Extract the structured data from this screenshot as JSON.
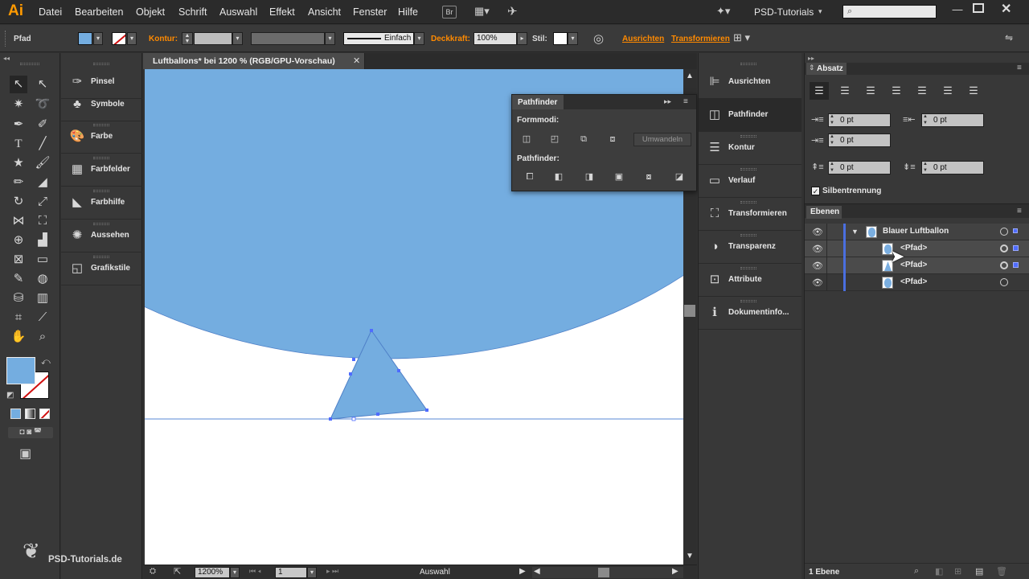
{
  "app": {
    "logo": "Ai",
    "workspace": "PSD-Tutorials"
  },
  "menu": [
    "Datei",
    "Bearbeiten",
    "Objekt",
    "Schrift",
    "Auswahl",
    "Effekt",
    "Ansicht",
    "Fenster",
    "Hilfe"
  ],
  "menubar_icons": {
    "bridge": "Br"
  },
  "controlbar": {
    "object_type": "Pfad",
    "kontur_label": "Kontur:",
    "stroke_profile": "Einfach",
    "opacity_label": "Deckkraft:",
    "opacity_value": "100%",
    "style_label": "Stil:",
    "align_link": "Ausrichten",
    "transform_link": "Transformieren"
  },
  "colors": {
    "fill": "#74ade0",
    "accent": "#ff8a00",
    "selection": "#4f6cff"
  },
  "left_panels": [
    "Pinsel",
    "Symbole",
    "Farbe",
    "Farbfelder",
    "Farbhilfe",
    "Aussehen",
    "Grafikstile"
  ],
  "document": {
    "tab_title": "Luftballons* bei 1200 % (RGB/GPU-Vorschau)"
  },
  "pathfinder": {
    "title": "Pathfinder",
    "shape_modes_label": "Formmodi:",
    "expand_button": "Umwandeln",
    "pathfinders_label": "Pathfinder:"
  },
  "right_panels": [
    "Ausrichten",
    "Pathfinder",
    "Kontur",
    "Verlauf",
    "Transformieren",
    "Transparenz",
    "Attribute",
    "Dokumentinfo..."
  ],
  "absatz": {
    "title": "Absatz",
    "left_indent": "0 pt",
    "right_indent": "0 pt",
    "first_line_indent": "0 pt",
    "space_before": "0 pt",
    "space_after": "0 pt",
    "hyphenation_label": "Silbentrennung"
  },
  "layers": {
    "tab": "Ebenen",
    "items": [
      {
        "name": "Blauer Luftballon"
      },
      {
        "name": "<Pfad>"
      },
      {
        "name": "<Pfad>"
      },
      {
        "name": "<Pfad>"
      }
    ],
    "count": "1 Ebene"
  },
  "status": {
    "zoom": "1200%",
    "artboard": "1",
    "tool": "Auswahl"
  },
  "watermark": "PSD-Tutorials.de"
}
